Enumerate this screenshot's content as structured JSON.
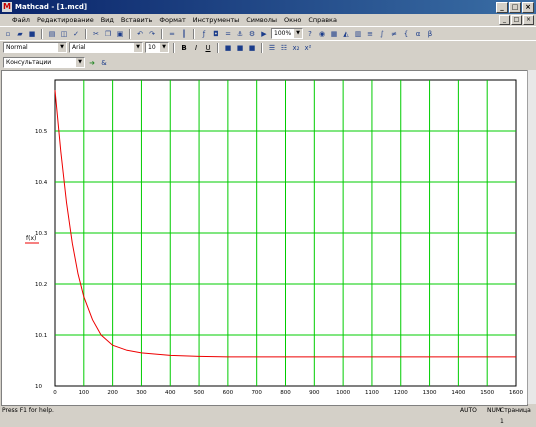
{
  "window": {
    "title": "Mathcad - [1.mcd]",
    "controls": [
      "_",
      "□",
      "×"
    ]
  },
  "menu": [
    "Файл",
    "Редактирование",
    "Вид",
    "Вставить",
    "Формат",
    "Инструменты",
    "Символы",
    "Окно",
    "Справка"
  ],
  "doc_controls": [
    "_",
    "□",
    "×"
  ],
  "toolbar": {
    "zoom": "100%",
    "style": "Normal",
    "font": "Arial",
    "font_size": "10",
    "bold": "B",
    "italic": "I",
    "underline": "U"
  },
  "resources": {
    "selected": "Консультации"
  },
  "colors": {
    "grid": "#00cc00",
    "trace": "#ee0000",
    "title_bar": "#0a246a"
  },
  "chart_data": {
    "type": "line",
    "legend": "f(x)",
    "xlim": [
      0,
      1600
    ],
    "ylim": [
      10,
      10.6
    ],
    "x_ticks": [
      0,
      100,
      200,
      300,
      400,
      500,
      600,
      700,
      800,
      900,
      1000,
      1100,
      1200,
      1300,
      1400,
      1500,
      1600
    ],
    "y_ticks": [
      10,
      10.1,
      10.2,
      10.3,
      10.4,
      10.5
    ],
    "y_tick_labels": [
      "10",
      "10.1",
      "10.2",
      "10.3",
      "10.4",
      "10.5"
    ],
    "grid": true,
    "series": [
      {
        "x": [
          0,
          10,
          20,
          40,
          60,
          80,
          100,
          130,
          160,
          200,
          250,
          300,
          400,
          500,
          600,
          700,
          800,
          1000,
          1200,
          1400,
          1600
        ],
        "y": [
          10.58,
          10.52,
          10.46,
          10.36,
          10.28,
          10.22,
          10.175,
          10.13,
          10.1,
          10.08,
          10.07,
          10.065,
          10.06,
          10.058,
          10.057,
          10.057,
          10.057,
          10.057,
          10.057,
          10.057,
          10.057
        ]
      }
    ]
  },
  "status": {
    "hint": "Press F1 for help.",
    "mode": "AUTO",
    "num": "NUM",
    "page": "Страница 1"
  }
}
